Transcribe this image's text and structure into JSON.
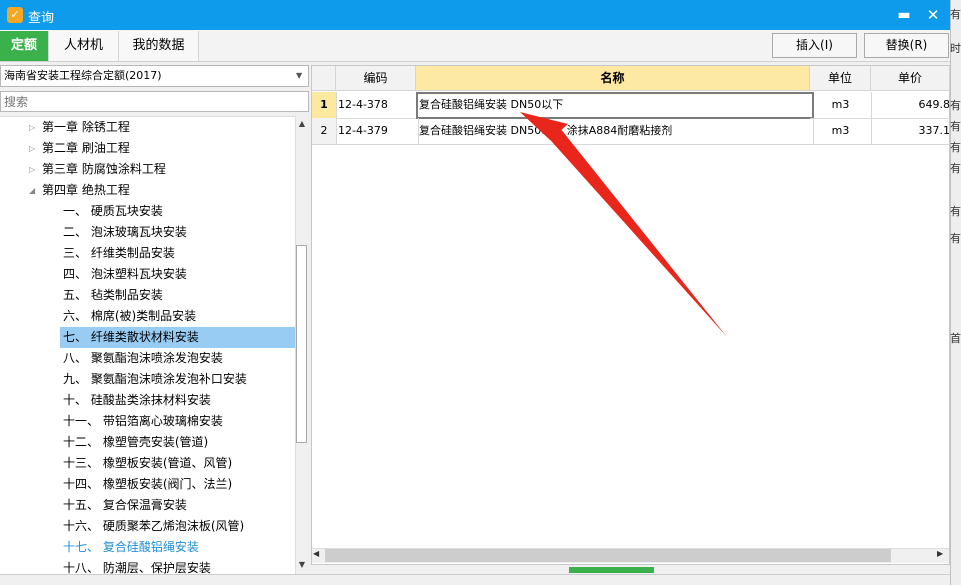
{
  "window": {
    "title": "查询",
    "minimize_glyph": "▬",
    "close_glyph": "✕",
    "icon": "app-logo-icon"
  },
  "tabs": [
    {
      "label": "定额",
      "active": true
    },
    {
      "label": "人材机",
      "active": false
    },
    {
      "label": "我的数据",
      "active": false
    }
  ],
  "actions": {
    "insert_label": "插入(I)",
    "replace_label": "替换(R)"
  },
  "left": {
    "quota_select_value": "海南省安装工程综合定额(2017)",
    "search_placeholder": "搜索",
    "tree": [
      {
        "label": "第一章 除锈工程",
        "level": 0,
        "expanded": false
      },
      {
        "label": "第二章 刷油工程",
        "level": 0,
        "expanded": false
      },
      {
        "label": "第三章 防腐蚀涂料工程",
        "level": 0,
        "expanded": false
      },
      {
        "label": "第四章 绝热工程",
        "level": 0,
        "expanded": true
      },
      {
        "label": "一、 硬质瓦块安装",
        "level": 1
      },
      {
        "label": "二、 泡沫玻璃瓦块安装",
        "level": 1
      },
      {
        "label": "三、 纤维类制品安装",
        "level": 1
      },
      {
        "label": "四、 泡沫塑料瓦块安装",
        "level": 1
      },
      {
        "label": "五、 毡类制品安装",
        "level": 1
      },
      {
        "label": "六、 棉席(被)类制品安装",
        "level": 1
      },
      {
        "label": "七、 纤维类散状材料安装",
        "level": 1,
        "selected": true
      },
      {
        "label": "八、 聚氨酯泡沫喷涂发泡安装",
        "level": 1
      },
      {
        "label": "九、 聚氨酯泡沫喷涂发泡补口安装",
        "level": 1
      },
      {
        "label": "十、 硅酸盐类涂抹材料安装",
        "level": 1
      },
      {
        "label": "十一、 带铝箔离心玻璃棉安装",
        "level": 1
      },
      {
        "label": "十二、 橡塑管壳安装(管道)",
        "level": 1
      },
      {
        "label": "十三、 橡塑板安装(管道、风管)",
        "level": 1
      },
      {
        "label": "十四、 橡塑板安装(阀门、法兰)",
        "level": 1
      },
      {
        "label": "十五、 复合保温膏安装",
        "level": 1
      },
      {
        "label": "十六、 硬质聚苯乙烯泡沫板(风管)",
        "level": 1
      },
      {
        "label": "十七、 复合硅酸铝绳安装",
        "level": 1,
        "highlight": true
      },
      {
        "label": "十八、 防潮层、保护层安装",
        "level": 1
      }
    ]
  },
  "grid": {
    "headers": {
      "code": "编码",
      "name": "名称",
      "unit": "单位",
      "price": "单价"
    },
    "rows": [
      {
        "num": "1",
        "code": "12-4-378",
        "name": "复合硅酸铝绳安装 DN50以下",
        "unit": "m3",
        "price": "649.8"
      },
      {
        "num": "2",
        "code": "12-4-379",
        "name": "复合硅酸铝绳安装 DN50以下 涂抹A884耐磨粘接剂",
        "unit": "m3",
        "price": "337.1"
      }
    ]
  },
  "edge_fragments": [
    "有",
    "时",
    "有",
    "有",
    "有",
    "有",
    "有",
    "有",
    "首"
  ],
  "colors": {
    "title_bar": "#0f9bec",
    "active_tab": "#3ab14a",
    "annotation_arrow": "#e8261c",
    "selected_row": "#99ccf3"
  }
}
